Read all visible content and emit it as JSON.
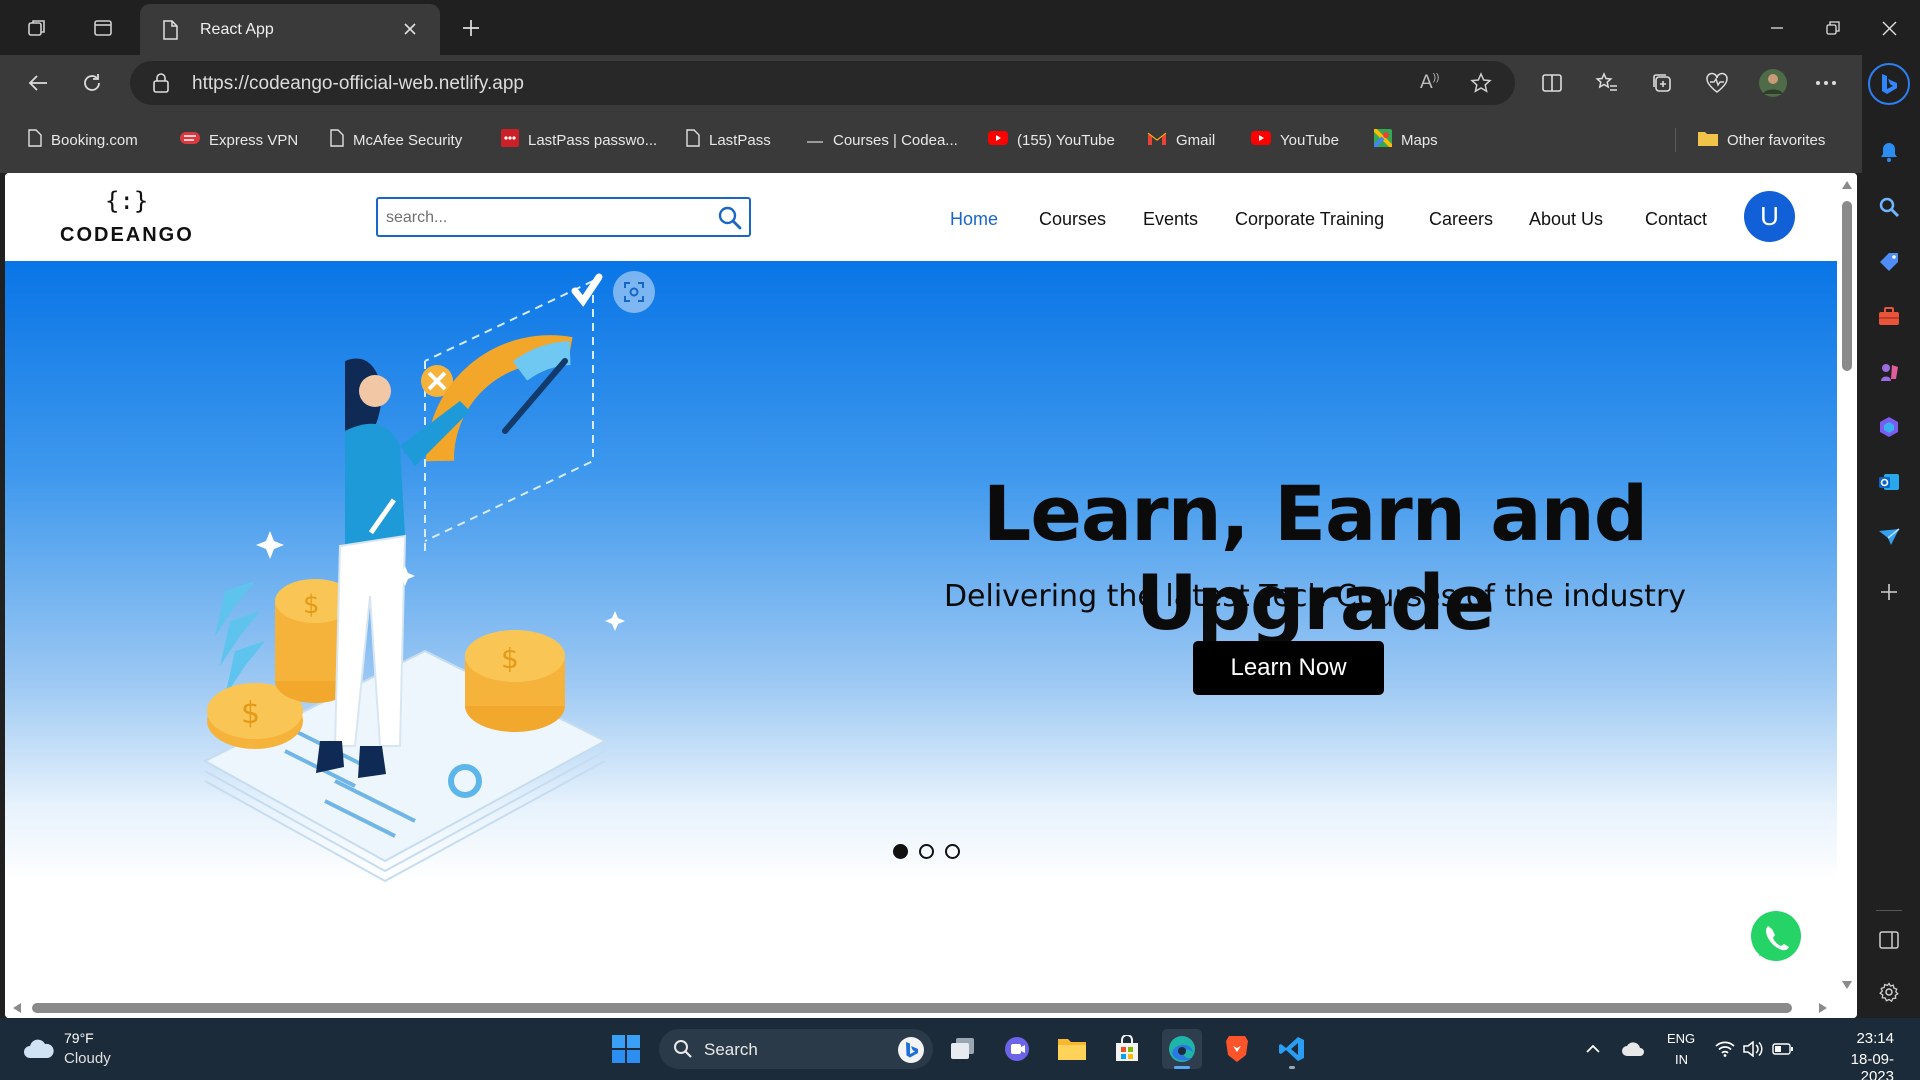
{
  "browser": {
    "tab_title": "React App",
    "url": "https://codeango-official-web.netlify.app",
    "bookmarks": [
      {
        "label": "Booking.com",
        "icon": "page-icon"
      },
      {
        "label": "Express VPN",
        "icon": "expressvpn-icon"
      },
      {
        "label": "McAfee Security",
        "icon": "page-icon"
      },
      {
        "label": "LastPass passwo...",
        "icon": "lastpass-icon"
      },
      {
        "label": "LastPass",
        "icon": "page-icon"
      },
      {
        "label": "Courses | Codea...",
        "icon": "dash-icon"
      },
      {
        "label": "(155) YouTube",
        "icon": "youtube-icon"
      },
      {
        "label": "Gmail",
        "icon": "gmail-icon"
      },
      {
        "label": "YouTube",
        "icon": "youtube-icon"
      },
      {
        "label": "Maps",
        "icon": "maps-icon"
      }
    ],
    "other_favorites": "Other favorites"
  },
  "site": {
    "logo_symbol": "{:}",
    "logo_text": "CODEANGO",
    "search_placeholder": "search...",
    "nav": [
      "Home",
      "Courses",
      "Events",
      "Corporate Training",
      "Careers",
      "About Us",
      "Contact"
    ],
    "active_nav": "Home",
    "avatar_letter": "U",
    "hero": {
      "title": "Learn, Earn and Upgrade",
      "subtitle": "Delivering the latest Tech Courses of the industry",
      "cta": "Learn Now",
      "slide_count": 3,
      "active_slide": 1
    }
  },
  "taskbar": {
    "weather_temp": "79°F",
    "weather_desc": "Cloudy",
    "search_label": "Search",
    "lang_line1": "ENG",
    "lang_line2": "IN",
    "time": "23:14",
    "date": "18-09-2023"
  },
  "colors": {
    "accent": "#1a66c8",
    "avatar": "#1160d8",
    "hero_top": "#0975e6",
    "cta": "#000000",
    "whatsapp": "#25d366"
  }
}
